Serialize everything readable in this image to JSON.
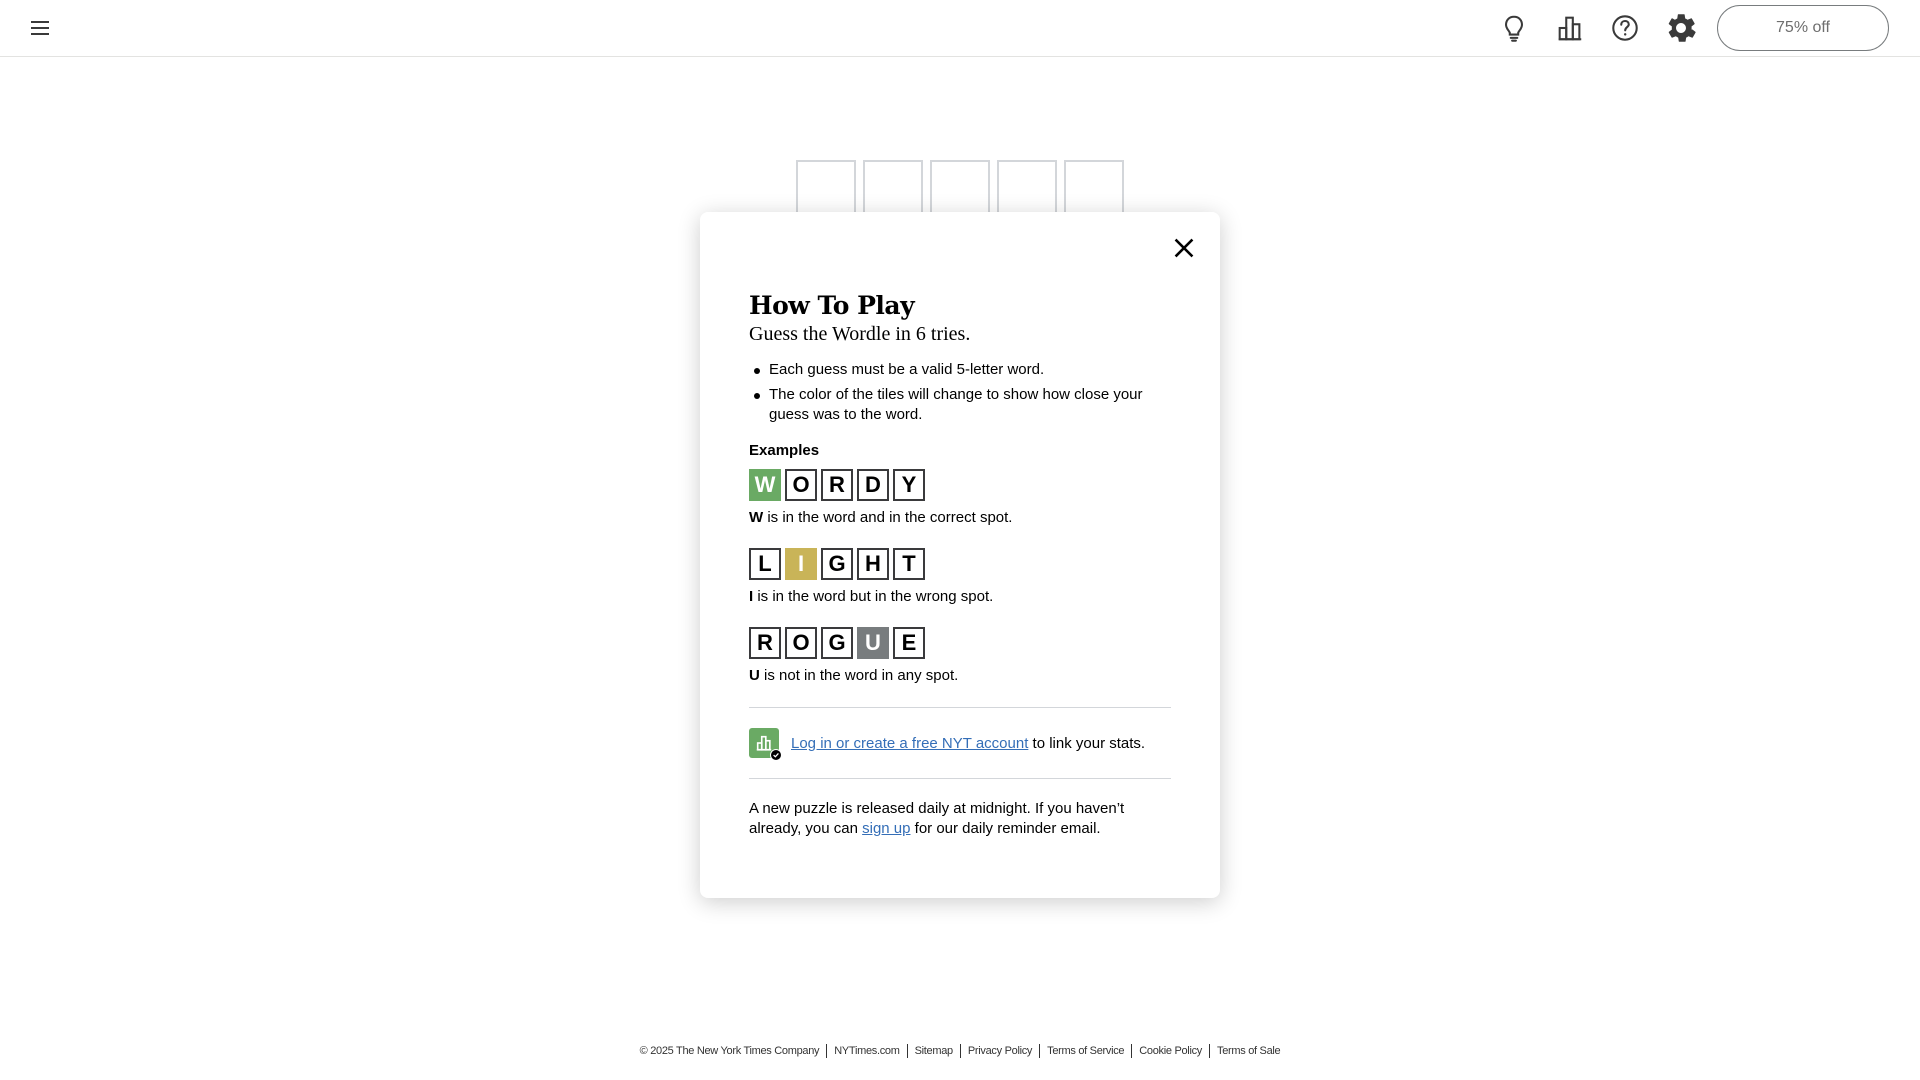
{
  "header": {
    "offer_label": "75% off"
  },
  "board": {
    "tiles": [
      "",
      "",
      "",
      "",
      ""
    ]
  },
  "modal": {
    "title": "How To Play",
    "subtitle": "Guess the Wordle in 6 tries.",
    "rules": [
      "Each guess must be a valid 5-letter word.",
      "The color of the tiles will change to show how close your guess was to the word."
    ],
    "examples_title": "Examples",
    "examples": [
      {
        "letters": [
          "W",
          "O",
          "R",
          "D",
          "Y"
        ],
        "states": [
          "correct",
          "empty",
          "empty",
          "empty",
          "empty"
        ],
        "highlight": "W",
        "description": " is in the word and in the correct spot."
      },
      {
        "letters": [
          "L",
          "I",
          "G",
          "H",
          "T"
        ],
        "states": [
          "empty",
          "present",
          "empty",
          "empty",
          "empty"
        ],
        "highlight": "I",
        "description": " is in the word but in the wrong spot."
      },
      {
        "letters": [
          "R",
          "O",
          "G",
          "U",
          "E"
        ],
        "states": [
          "empty",
          "empty",
          "empty",
          "absent",
          "empty"
        ],
        "highlight": "U",
        "description": " is not in the word in any spot."
      }
    ],
    "stats_link": "Log in or create a free NYT account",
    "stats_suffix": " to link your stats.",
    "note_prefix": "A new puzzle is released daily at midnight. If you haven’t already, you can ",
    "note_link": "sign up",
    "note_suffix": " for our daily reminder email."
  },
  "footer": {
    "copyright": "© 2025 The New York Times Company",
    "links": [
      "NYTimes.com",
      "Sitemap",
      "Privacy Policy",
      "Terms of Service",
      "Cookie Policy",
      "Terms of Sale"
    ]
  },
  "colors": {
    "correct": "#6aaa64",
    "present": "#c9b458",
    "absent": "#787c7e",
    "link": "#346eb7"
  },
  "icons": [
    "menu-icon",
    "hint-bulb-icon",
    "stats-icon",
    "help-icon",
    "settings-gear-icon",
    "close-icon"
  ]
}
